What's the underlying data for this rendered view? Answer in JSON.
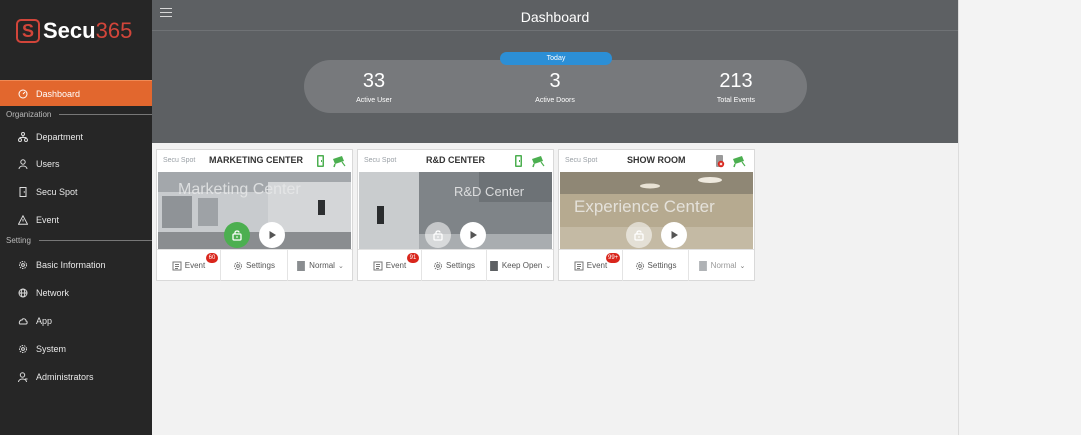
{
  "logo": {
    "mark": "S",
    "text_a": "Secu",
    "text_b": "365"
  },
  "header": {
    "title": "Dashboard"
  },
  "stats": {
    "badge": "Today",
    "items": [
      {
        "value": "33",
        "label": "Active User"
      },
      {
        "value": "3",
        "label": "Active Doors"
      },
      {
        "value": "213",
        "label": "Total Events"
      }
    ]
  },
  "sidebar": {
    "items": [
      {
        "label": "Dashboard",
        "icon": "dashboard-icon",
        "active": true
      },
      {
        "label": "Department",
        "icon": "department-icon"
      },
      {
        "label": "Users",
        "icon": "user-icon"
      },
      {
        "label": "Secu Spot",
        "icon": "door-icon"
      },
      {
        "label": "Event",
        "icon": "warning-icon"
      },
      {
        "label": "Basic Information",
        "icon": "gear-icon"
      },
      {
        "label": "Network",
        "icon": "globe-icon"
      },
      {
        "label": "App",
        "icon": "cloud-icon"
      },
      {
        "label": "System",
        "icon": "gear-icon"
      },
      {
        "label": "Administrators",
        "icon": "admin-icon"
      }
    ],
    "sections": [
      "Organization",
      "Setting"
    ]
  },
  "cards": [
    {
      "type": "Secu Spot",
      "name": "MARKETING CENTER",
      "event_label": "Event",
      "event_badge": "60",
      "settings_label": "Settings",
      "mode": "Normal",
      "lock_active": true,
      "door_color": "#4caf50",
      "photo_text": "Marketing Center"
    },
    {
      "type": "Secu Spot",
      "name": "R&D CENTER",
      "event_label": "Event",
      "event_badge": "91",
      "settings_label": "Settings",
      "mode": "Keep Open",
      "lock_active": false,
      "door_color": "#4caf50",
      "photo_text": "R&D Center"
    },
    {
      "type": "Secu Spot",
      "name": "SHOW ROOM",
      "event_label": "Event",
      "event_badge": "99+",
      "settings_label": "Settings",
      "mode": "Normal",
      "lock_active": false,
      "door_color": "#d9261c",
      "photo_text": "Experience Center"
    }
  ],
  "colors": {
    "accent": "#e2672e",
    "today": "#2c8fd6",
    "green": "#4caf50",
    "alert": "#d9261c"
  }
}
